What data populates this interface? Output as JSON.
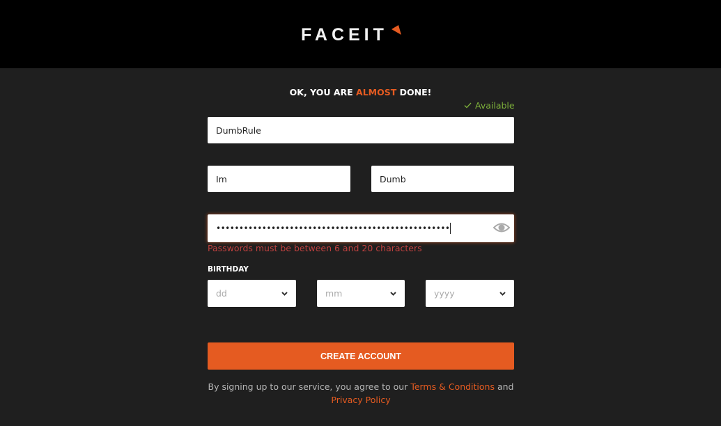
{
  "header": {
    "logo_text": "FACEIT"
  },
  "form": {
    "title_prefix": "OK, YOU ARE ",
    "title_accent": "ALMOST",
    "title_suffix": " DONE!",
    "username_status": "Available",
    "username_value": "DumbRule",
    "first_name_value": "Im",
    "last_name_value": "Dumb",
    "password_masked": "•••••••••••••••••••••••••••••••••••••••••••••••••••",
    "password_error": "Passwords must be between 6 and 20 characters",
    "birthday_label": "BIRTHDAY",
    "birthday": {
      "day_placeholder": "dd",
      "month_placeholder": "mm",
      "year_placeholder": "yyyy"
    },
    "submit_label": "CREATE ACCOUNT",
    "terms_prefix": "By signing up to our service, you agree to our ",
    "terms_link": "Terms & Conditions",
    "terms_middle": " and",
    "privacy_link": "Privacy Policy"
  },
  "colors": {
    "accent": "#e55b21",
    "success": "#7cae3a",
    "error": "#c0413f",
    "background": "#1f1f1f",
    "header": "#000000"
  }
}
